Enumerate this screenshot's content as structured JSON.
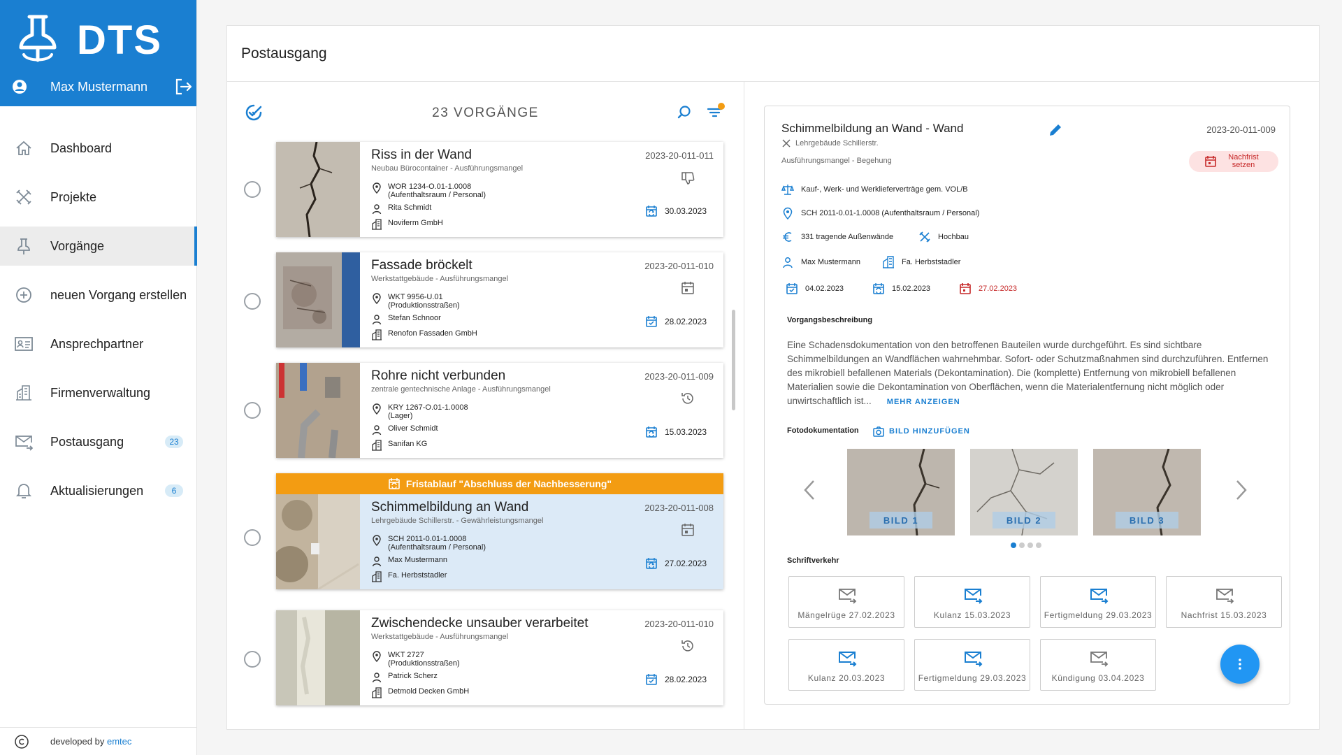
{
  "brand": {
    "name": "DTS",
    "user": "Max Mustermann"
  },
  "nav": [
    {
      "label": "Dashboard",
      "icon": "home-icon",
      "badge": ""
    },
    {
      "label": "Projekte",
      "icon": "tools-icon",
      "badge": ""
    },
    {
      "label": "Vorgänge",
      "icon": "pin-icon",
      "badge": "",
      "active": true
    },
    {
      "label": "neuen Vorgang erstellen",
      "icon": "plus-circle-icon",
      "badge": ""
    },
    {
      "label": "Ansprechpartner",
      "icon": "contact-card-icon",
      "badge": ""
    },
    {
      "label": "Firmenverwaltung",
      "icon": "building-icon",
      "badge": ""
    },
    {
      "label": "Postausgang",
      "icon": "mail-out-icon",
      "badge": "23"
    },
    {
      "label": "Aktualisierungen",
      "icon": "bell-icon",
      "badge": "6"
    }
  ],
  "footer": {
    "prefix": "developed by",
    "company": "emtec"
  },
  "page": {
    "title": "Postausgang"
  },
  "list": {
    "count_label": "23 VORGÄNGE",
    "cases": [
      {
        "title": "Riss in der Wand",
        "subtitle": "Neubau Bürocontainer - Ausführungsmangel",
        "number": "2023-20-011-011",
        "location": "WOR 1234-O.01-1.0008",
        "location2": "(Aufenthaltsraum / Personal)",
        "person": "Rita Schmidt",
        "company": "Noviferm GmbH",
        "date": "30.03.2023",
        "status_icon": "thumb-down-icon",
        "date_icon": "calendar-sync-icon"
      },
      {
        "title": "Fassade bröckelt",
        "subtitle": "Werkstattgebäude - Ausführungsmangel",
        "number": "2023-20-011-010",
        "location": "WKT 9956-U.01",
        "location2": "(Produktionsstraßen)",
        "person": "Stefan Schnoor",
        "company": "Renofon Fassaden GmbH",
        "date": "28.02.2023",
        "status_icon": "calendar-icon",
        "date_icon": "calendar-check-icon"
      },
      {
        "title": "Rohre nicht verbunden",
        "subtitle": "zentrale gentechnische Anlage - Ausführungsmangel",
        "number": "2023-20-011-009",
        "location": "KRY 1267-O.01-1.0008",
        "location2": "(Lager)",
        "person": "Oliver Schmidt",
        "company": "Sanifan KG",
        "date": "15.03.2023",
        "status_icon": "history-icon",
        "date_icon": "calendar-sync-icon"
      },
      {
        "title": "Schimmelbildung an Wand",
        "subtitle": "Lehrgebäude Schillerstr. - Gewährleistungsmangel",
        "number": "2023-20-011-008",
        "location": "SCH 2011-0.01-1.0008",
        "location2": "(Aufenthaltsraum / Personal)",
        "person": "Max Mustermann",
        "company": "Fa. Herbststadler",
        "date": "27.02.2023",
        "status_icon": "calendar-icon",
        "date_icon": "calendar-sync-icon",
        "banner": "Fristablauf \"Abschluss der Nachbesserung\""
      },
      {
        "title": "Zwischendecke unsauber verarbeitet",
        "subtitle": "Werkstattgebäude - Ausführungsmangel",
        "number": "2023-20-011-010",
        "location": "WKT 2727",
        "location2": "(Produktionsstraßen)",
        "person": "Patrick Scherz",
        "company": "Detmold Decken GmbH",
        "date": "28.02.2023",
        "status_icon": "history-icon",
        "date_icon": "calendar-check-icon"
      }
    ]
  },
  "detail": {
    "title": "Schimmelbildung an Wand - Wand",
    "project": "Lehrgebäude Schillerstr.",
    "number": "2023-20-011-009",
    "type": "Ausführungsmangel - Begehung",
    "nachfrist_label": "Nachfrist setzen",
    "contract": "Kauf-, Werk- und Werklieferverträge gem. VOL/B",
    "location": "SCH 2011-0.01-1.0008 (Aufenthaltsraum / Personal)",
    "cost_group": "331 tragende Außenwände",
    "trade": "Hochbau",
    "person": "Max Mustermann",
    "company": "Fa. Herbststadler",
    "date1": "04.02.2023",
    "date2": "15.02.2023",
    "date3": "27.02.2023",
    "desc_label": "Vorgangsbeschreibung",
    "description": "Eine Schadensdokumentation von den betroffenen Bauteilen wurde durchgeführt. Es sind sichtbare Schimmelbildungen an Wandflächen wahrnehmbar. Sofort- oder Schutzmaßnahmen sind durchzuführen. Entfernen des mikrobiell befallenen Materials (Dekontamination). Die (komplette) Entfernung von mikrobiell befallenen Materialien sowie die Dekontamination von Oberflächen, wenn die Materialentfernung nicht möglich oder unwirtschaftlich ist...",
    "more_label": "MEHR ANZEIGEN",
    "photo_label": "Fotodokumentation",
    "add_photo": "BILD HINZUFÜGEN",
    "photos": [
      "BILD 1",
      "BILD 2",
      "BILD 3"
    ],
    "corr_label": "Schriftverkehr",
    "mails": [
      {
        "label": "Mängelrüge 27.02.2023",
        "state": "sent"
      },
      {
        "label": "Kulanz 15.03.2023",
        "state": "pending"
      },
      {
        "label": "Fertigmeldung 29.03.2023",
        "state": "pending"
      },
      {
        "label": "Nachfrist 15.03.2023",
        "state": "sent"
      },
      {
        "label": "Kulanz 20.03.2023",
        "state": "pending"
      },
      {
        "label": "Fertigmeldung 29.03.2023",
        "state": "pending"
      },
      {
        "label": "Kündigung 03.04.2023",
        "state": "sent"
      }
    ]
  },
  "colors": {
    "primary": "#1a7fd1",
    "warning": "#f39c12",
    "danger": "#c62828",
    "selected": "#dceaf7"
  }
}
